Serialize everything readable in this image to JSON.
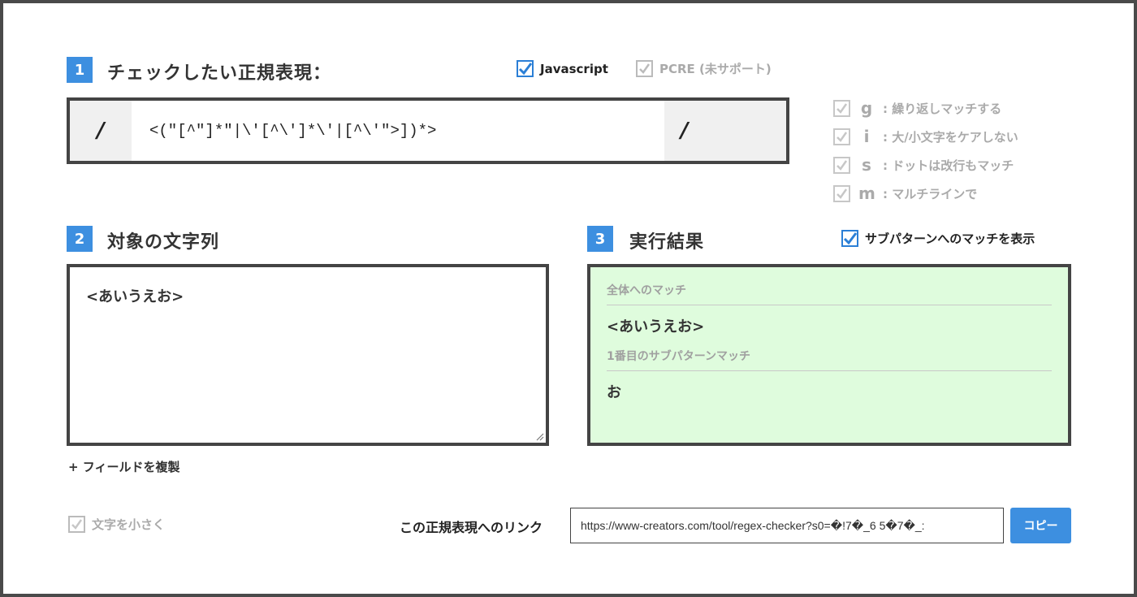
{
  "section1": {
    "number": "1",
    "title": "チェックしたい正規表現：",
    "options": [
      {
        "label": "Javascript",
        "checked": true
      },
      {
        "label": "PCRE (未サポート)",
        "checked": true,
        "disabled": true
      }
    ]
  },
  "regex": {
    "open_slash": "/",
    "pattern": "<(\"[^\"]*\"|\\'[^\\']*\\'|[^\\'\">])*>",
    "close_slash": "/"
  },
  "flags": [
    {
      "letter": "g",
      "desc": ": 繰り返しマッチする"
    },
    {
      "letter": "i",
      "desc": ": 大/小文字をケアしない"
    },
    {
      "letter": "s",
      "desc": ": ドットは改行もマッチ"
    },
    {
      "letter": "m",
      "desc": ": マルチラインで"
    }
  ],
  "section2": {
    "number": "2",
    "title": "対象の文字列",
    "text": "<あいうえお>",
    "duplicate_link": "+ フィールドを複製"
  },
  "section3": {
    "number": "3",
    "title": "実行結果",
    "show_sub_label": "サブパターンへのマッチを表示",
    "full_match_label": "全体へのマッチ",
    "full_match_value": "<あいうえお>",
    "sub_match_label": "1番目のサブパターンマッチ",
    "sub_match_value": "お"
  },
  "footer": {
    "small_text_label": "文字を小さく",
    "link_label": "この正規表現へのリンク",
    "link_value": "https://www-creators.com/tool/regex-checker?s0=�!7�_6 5�7�_:",
    "copy_label": "コピー"
  },
  "colors": {
    "accent": "#3d8fe0",
    "result_bg": "#dffcdd",
    "border": "#444444"
  }
}
